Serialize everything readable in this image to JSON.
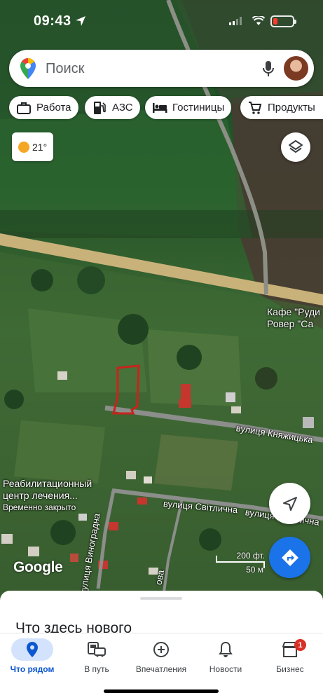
{
  "status_bar": {
    "time": "09:43"
  },
  "search": {
    "placeholder": "Поиск"
  },
  "chips": [
    {
      "label": "Работа",
      "icon": "briefcase-icon"
    },
    {
      "label": "АЗС",
      "icon": "gas-station-icon"
    },
    {
      "label": "Гостиницы",
      "icon": "bed-icon"
    },
    {
      "label": "Продукты",
      "icon": "cart-icon"
    }
  ],
  "weather": {
    "temp": "21°",
    "icon": "sun-icon"
  },
  "map_labels": {
    "cafe_line1": "Кафе \"Руди",
    "cafe_line2": "Ровер \"Са",
    "street_knyazhytska": "вулиця Княжицька",
    "street_svitlychna_1": "вулиця Світлична",
    "street_svitlychna_2": "вулиця Світлична",
    "rehab_line1": "Реабилитационный",
    "rehab_line2": "центр лечения...",
    "rehab_status": "Временно закрыто",
    "street_vynohradna": "вулиця Виноградна",
    "street_partial": "ова"
  },
  "map_footer": {
    "logo": "Google",
    "scale_ft": "200 фт.",
    "scale_m": "50 м"
  },
  "sheet": {
    "title": "Что здесь нового"
  },
  "tabs": [
    {
      "label": "Что рядом",
      "icon": "location-pin-icon",
      "active": true
    },
    {
      "label": "В путь",
      "icon": "commute-icon"
    },
    {
      "label": "Впечатления",
      "icon": "add-circle-icon"
    },
    {
      "label": "Новости",
      "icon": "bell-icon"
    },
    {
      "label": "Бизнес",
      "icon": "storefront-icon",
      "badge": "1"
    }
  ],
  "colors": {
    "accent": "#1a73e8",
    "marker": "#c8241c",
    "badge": "#d93025"
  }
}
